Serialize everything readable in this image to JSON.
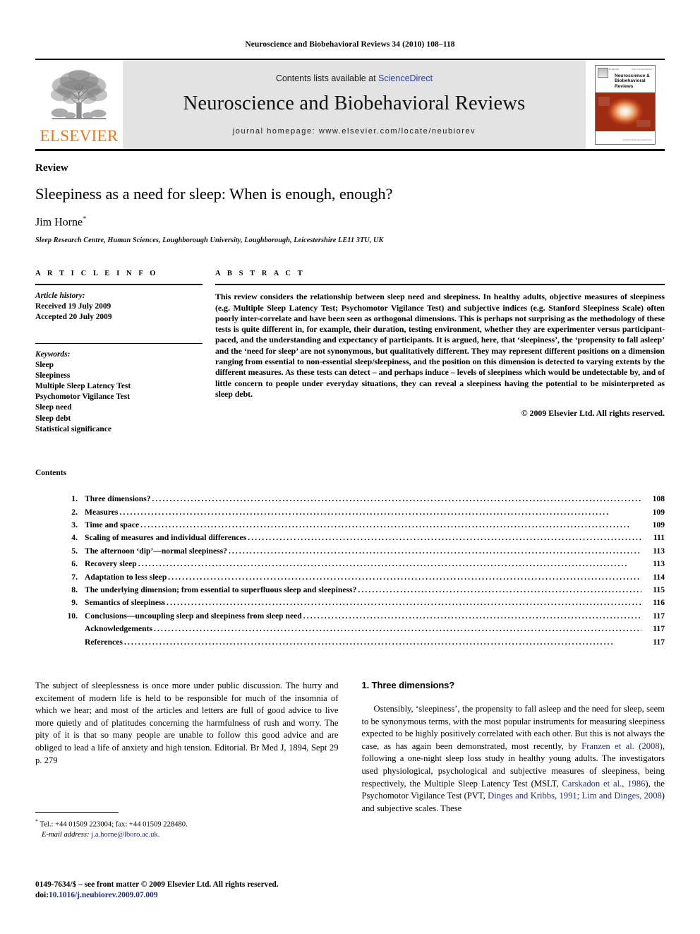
{
  "running_head": "Neuroscience and Biobehavioral Reviews 34 (2010) 108–118",
  "masthead": {
    "publisher_name": "ELSEVIER",
    "contents_prefix": "Contents lists available at ",
    "sciencedirect": "ScienceDirect",
    "journal_title": "Neuroscience and Biobehavioral Reviews",
    "homepage": "journal homepage: www.elsevier.com/locate/neubiorev",
    "cover": {
      "journal_name": "Neuroscience & Biobehavioral Reviews",
      "top_left_tiny": "ELSEVIER",
      "top_right_tiny": "Also in ScienceDirect",
      "bottom_tiny": "Contents listed\nwww.elsevier.com"
    }
  },
  "article": {
    "type": "Review",
    "title": "Sleepiness as a need for sleep: When is enough, enough?",
    "author": "Jim Horne",
    "corresponding_marker": "*",
    "affiliation": "Sleep Research Centre, Human Sciences, Loughborough University, Loughborough, Leicestershire LE11 3TU, UK"
  },
  "article_info": {
    "label": "A R T I C L E   I N F O",
    "history_heading": "Article history:",
    "history": [
      "Received 19 July 2009",
      "Accepted 20 July 2009"
    ],
    "keywords_heading": "Keywords:",
    "keywords": [
      "Sleep",
      "Sleepiness",
      "Multiple Sleep Latency Test",
      "Psychomotor Vigilance Test",
      "Sleep need",
      "Sleep debt",
      "Statistical significance"
    ]
  },
  "abstract": {
    "label": "A B S T R A C T",
    "text": "This review considers the relationship between sleep need and sleepiness. In healthy adults, objective measures of sleepiness (e.g. Multiple Sleep Latency Test; Psychomotor Vigilance Test) and subjective indices (e.g. Stanford Sleepiness Scale) often poorly inter-correlate and have been seen as orthogonal dimensions. This is perhaps not surprising as the methodology of these tests is quite different in, for example, their duration, testing environment, whether they are experimenter versus participant-paced, and the understanding and expectancy of participants. It is argued, here, that ‘sleepiness’, the ‘propensity to fall asleep’ and the ‘need for sleep’ are not synonymous, but qualitatively different. They may represent different positions on a dimension ranging from essential to non-essential sleep/sleepiness, and the position on this dimension is detected to varying extents by the different measures. As these tests can detect – and perhaps induce – levels of sleepiness which would be undetectable by, and of little concern to people under everyday situations, they can reveal a sleepiness having the potential to be misinterpreted as sleep debt.",
    "copyright": "© 2009 Elsevier Ltd. All rights reserved."
  },
  "contents": {
    "heading": "Contents",
    "items": [
      {
        "num": "1.",
        "label": "Three dimensions?",
        "page": "108"
      },
      {
        "num": "2.",
        "label": "Measures",
        "page": "109"
      },
      {
        "num": "3.",
        "label": "Time and space",
        "page": "109"
      },
      {
        "num": "4.",
        "label": "Scaling of measures and individual differences",
        "page": "111"
      },
      {
        "num": "5.",
        "label": "The afternoon ‘dip’—normal sleepiness?",
        "page": "113"
      },
      {
        "num": "6.",
        "label": "Recovery sleep",
        "page": "113"
      },
      {
        "num": "7.",
        "label": "Adaptation to less sleep",
        "page": "114"
      },
      {
        "num": "8.",
        "label": "The underlying dimension; from essential to superfluous sleep and sleepiness?",
        "page": "115"
      },
      {
        "num": "9.",
        "label": "Semantics of sleepiness",
        "page": "116"
      },
      {
        "num": "10.",
        "label": "Conclusions—uncoupling sleep and sleepiness from sleep need",
        "page": "117"
      },
      {
        "num": "",
        "label": "Acknowledgements",
        "page": "117"
      },
      {
        "num": "",
        "label": "References",
        "page": "117"
      }
    ]
  },
  "body": {
    "left_quote": "The subject of sleeplessness is once more under public discussion. The hurry and excitement of modern life is held to be responsible for much of the insomnia of which we hear; and most of the articles and letters are full of good advice to live more quietly and of platitudes concerning the harmfulness of rush and worry. The pity of it is that so many people are unable to follow this good advice and are obliged to lead a life of anxiety and high tension. Editorial. Br Med J, 1894, Sept 29 p. 279",
    "footnote_tel": "Tel.: +44 01509 223004; fax: +44 01509 228480.",
    "footnote_email_label": "E-mail address:",
    "footnote_email": "j.a.horne@lboro.ac.uk.",
    "right_heading": "1. Three dimensions?",
    "right_par_part1": "Ostensibly, ‘sleepiness’, the propensity to fall asleep and the need for sleep, seem to be synonymous terms, with the most popular instruments for measuring sleepiness expected to be highly positively correlated with each other. But this is not always the case, as has again been demonstrated, most recently, by ",
    "right_ref1": "Franzen et al. (2008)",
    "right_par_part2": ", following a one-night sleep loss study in healthy young adults. The investigators used physiological, psychological and subjective measures of sleepiness, being respectively, the Multiple Sleep Latency Test (MSLT, ",
    "right_ref2": "Carskadon et al., 1986",
    "right_par_part3": "), the Psychomotor Vigilance Test (PVT, ",
    "right_ref3": "Dinges and Kribbs, 1991; Lim and Dinges, 2008",
    "right_par_part4": ") and subjective scales. These"
  },
  "footer": {
    "issn_line": "0149-7634/$ – see front matter © 2009 Elsevier Ltd. All rights reserved.",
    "doi_prefix": "doi:",
    "doi": "10.1016/j.neubiorev.2009.07.009"
  },
  "colors": {
    "link": "#1f2d7a",
    "elsevier_orange": "#E87722",
    "sciencedirect_blue": "#2b3f9e",
    "masthead_grey": "#e3e3e3"
  }
}
